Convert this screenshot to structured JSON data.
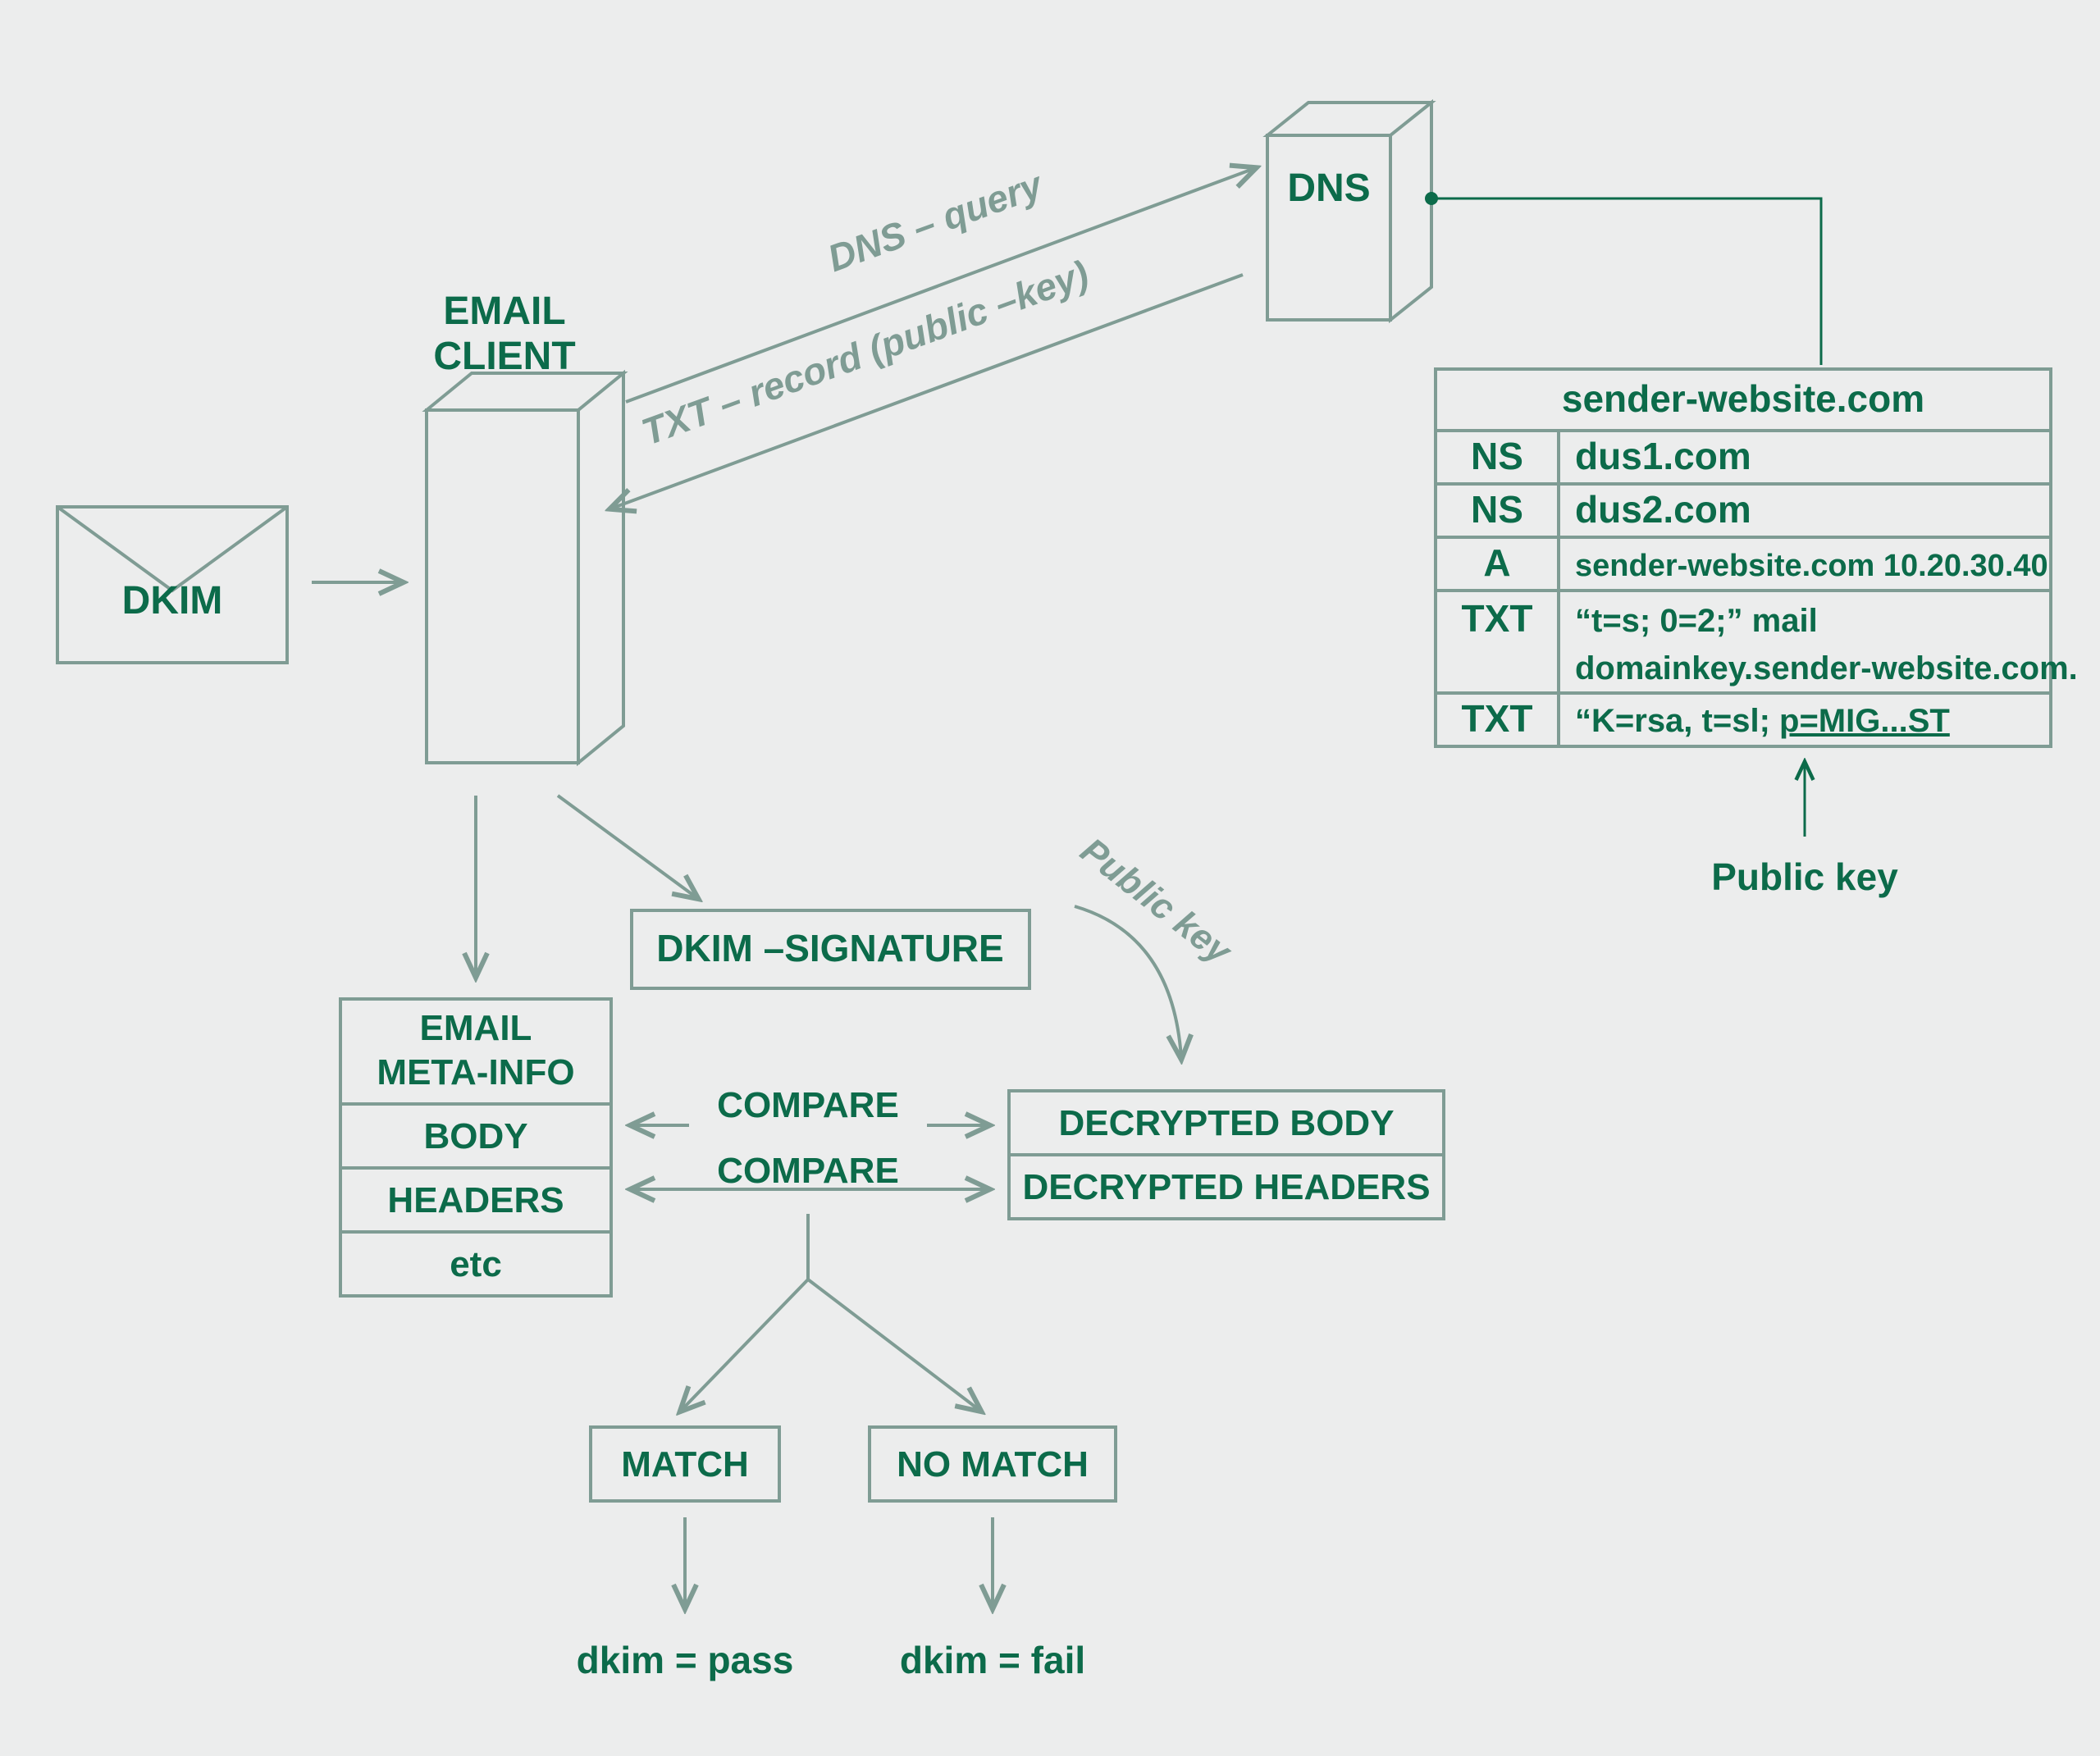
{
  "envelope_label": "DKIM",
  "email_client_label_1": "EMAIL",
  "email_client_label_2": "CLIENT",
  "dns_box_label": "DNS",
  "dns_query_label": "DNS – query",
  "txt_record_label": "TXT – record (public –key)",
  "dns_table": {
    "header": "sender-website.com",
    "rows": [
      {
        "type": "NS",
        "value": "dus1.com"
      },
      {
        "type": "NS",
        "value": "dus2.com"
      },
      {
        "type": "A",
        "value": "sender-website.com   10.20.30.40"
      },
      {
        "type": "TXT",
        "value_l1": "“t=s; 0=2;” mail",
        "value_l2": "domainkey.sender-website.com."
      },
      {
        "type": "TXT",
        "value_l1": "“K=rsa, t=sl; ",
        "value_l2": "p=MIG...ST"
      }
    ]
  },
  "public_key_curve": "Public key",
  "public_key_arrow": "Public key",
  "dkim_signature_label": "DKIM –SIGNATURE",
  "email_meta": {
    "row1_l1": "EMAIL",
    "row1_l2": "META-INFO",
    "row2": "BODY",
    "row3": "HEADERS",
    "row4": "etc"
  },
  "compare_1": "COMPARE",
  "compare_2": "COMPARE",
  "decrypted_body": "DECRYPTED BODY",
  "decrypted_headers": "DECRYPTED HEADERS",
  "match_label": "MATCH",
  "nomatch_label": "NO MATCH",
  "result_pass": "dkim = pass",
  "result_fail": "dkim = fail"
}
